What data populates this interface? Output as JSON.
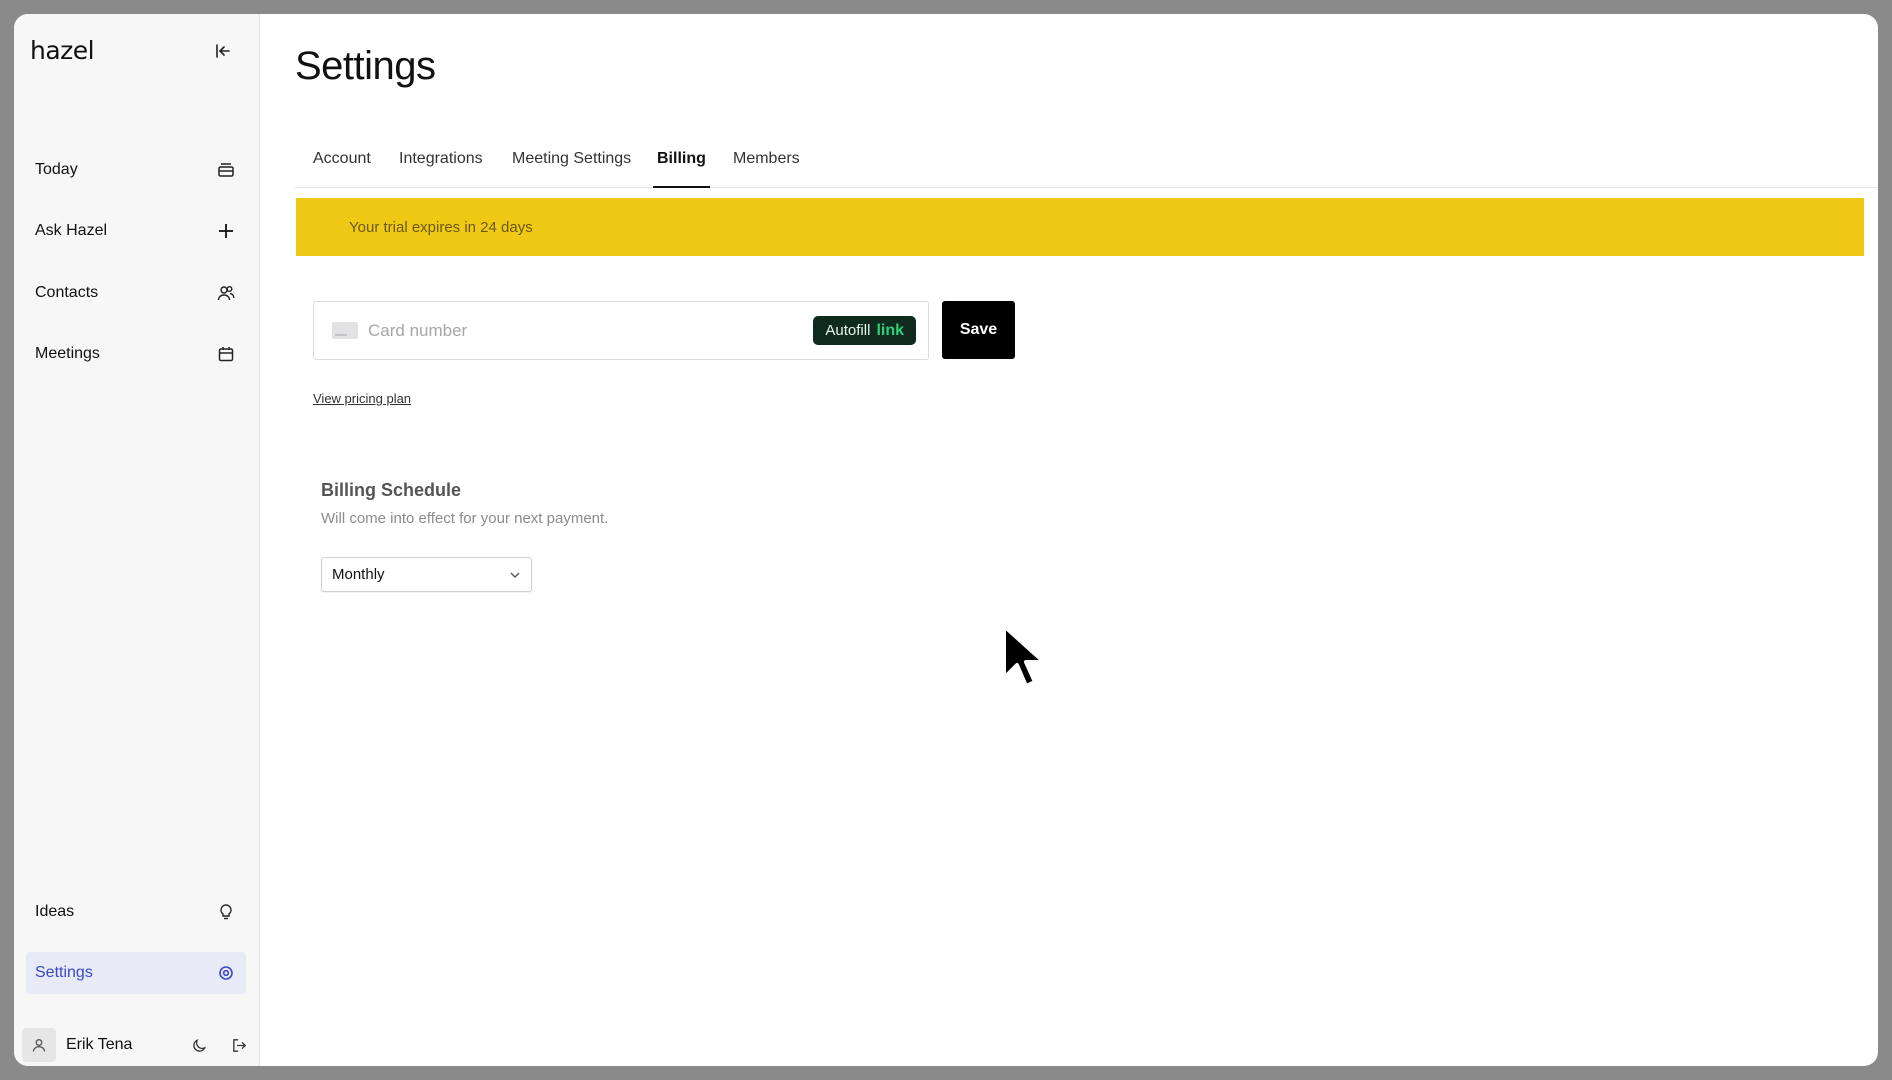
{
  "app": {
    "logo": "hazel"
  },
  "sidebar": {
    "items": [
      {
        "label": "Today",
        "icon": "today-icon"
      },
      {
        "label": "Ask Hazel",
        "icon": "plus-icon"
      },
      {
        "label": "Contacts",
        "icon": "contacts-icon"
      },
      {
        "label": "Meetings",
        "icon": "calendar-icon"
      }
    ],
    "bottom_items": [
      {
        "label": "Ideas",
        "icon": "lightbulb-icon"
      },
      {
        "label": "Settings",
        "icon": "settings-icon",
        "active": true
      }
    ],
    "user": {
      "name": "Erik Tena"
    }
  },
  "main": {
    "title": "Settings",
    "tabs": [
      {
        "label": "Account"
      },
      {
        "label": "Integrations"
      },
      {
        "label": "Meeting Settings"
      },
      {
        "label": "Billing",
        "active": true
      },
      {
        "label": "Members"
      }
    ],
    "banner": {
      "text": "Your trial expires in 24 days"
    },
    "payment": {
      "card_placeholder": "Card number",
      "autofill_label": "Autofill",
      "autofill_link": "link",
      "save_label": "Save",
      "pricing_link": "View pricing plan"
    },
    "billing_schedule": {
      "title": "Billing Schedule",
      "subtitle": "Will come into effect for your next payment.",
      "selected": "Monthly"
    }
  },
  "colors": {
    "banner": "#efc916",
    "active_nav": "#3b48c8",
    "autofill_bg": "#0e2b1d",
    "autofill_link": "#2fd07a"
  }
}
